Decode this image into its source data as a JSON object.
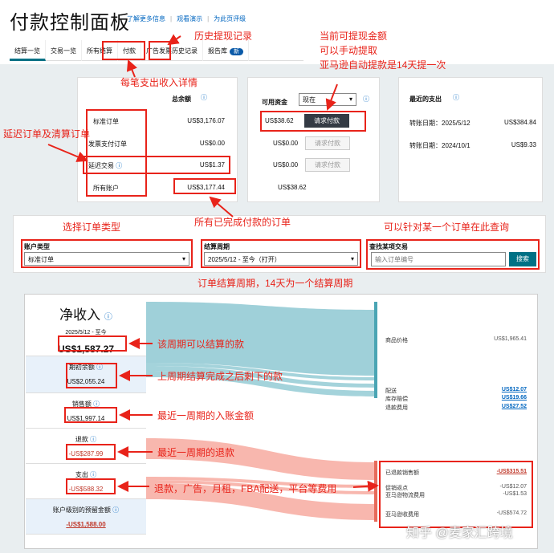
{
  "header": {
    "title": "付款控制面板",
    "links": [
      "了解更多信息",
      "观看演示",
      "为此页评级"
    ]
  },
  "tabs": [
    "结算一览",
    "交易一览",
    "所有结算",
    "付款",
    "广告发票历史记录",
    "报告库"
  ],
  "tab_badge": "新",
  "summary": {
    "col1_header": "总余额",
    "col2_header": "可用资金",
    "col2_select": "现在",
    "rows": [
      {
        "label": "标准订单",
        "total": "US$3,176.07",
        "avail": "US$38.62",
        "btn": "请求付款"
      },
      {
        "label": "发票支付订单",
        "total": "US$0.00",
        "avail": "US$0.00",
        "btn": "请求付款"
      },
      {
        "label": "延迟交易",
        "total": "US$1.37",
        "avail": "US$0.00",
        "btn": "请求付款"
      },
      {
        "label": "所有账户",
        "total": "US$3,177.44",
        "avail": "US$38.62",
        "btn": ""
      }
    ],
    "recent": {
      "title": "最近的支出",
      "rows": [
        {
          "label": "转账日期：2025/5/12",
          "value": "US$384.84"
        },
        {
          "label": "转账日期：2024/10/1",
          "value": "US$9.33"
        }
      ]
    }
  },
  "filters": {
    "account_type_label": "账户类型",
    "account_type_value": "标准订单",
    "period_label": "结算周期",
    "period_value": "2025/5/12 - 至今（打开）",
    "search_label": "查找某项交易",
    "search_placeholder": "输入订单编号",
    "search_btn": "搜索"
  },
  "net": {
    "title": "净收入",
    "date": "2025/5/12 - 至今",
    "value": "US$1,587.27",
    "items": [
      {
        "label": "期初余额",
        "value": "US$2,055.24"
      },
      {
        "label": "销售额",
        "value": "US$1,997.14"
      },
      {
        "label": "退款",
        "value": "-US$287.99"
      },
      {
        "label": "支出",
        "value": "-US$588.32"
      }
    ],
    "reserve_label": "账户级别的预留金额",
    "reserve_value": "-US$1,588.00"
  },
  "flows": [
    {
      "label": "商品价格",
      "value": "US$1,965.41",
      "u": false
    },
    {
      "label": "配送",
      "value": "US$12.07",
      "u": true
    },
    {
      "label": "库存赔偿",
      "value": "US$19.66",
      "u": true
    },
    {
      "label": "退款费用",
      "value": "US$27.52",
      "u": true
    },
    {
      "label": "已退款销售额",
      "value": "-US$315.51",
      "u": true
    },
    {
      "label": "促销返点",
      "value": "-US$12.07",
      "u": false
    },
    {
      "label": "亚马逊物流费用",
      "value": "-US$1.53",
      "u": false
    },
    {
      "label": "亚马逊收费用",
      "value": "-US$574.72",
      "u": false
    }
  ],
  "annotations": {
    "history": "历史提现记录",
    "withdraw1": "当前可提现金额",
    "withdraw2": "可以手动提取",
    "withdraw3": "亚马逊自动提款是14天提一次",
    "detail": "每笔支出收入详情",
    "delay": "延迟订单及清算订单",
    "done": "所有已完成付款的订单",
    "choose": "选择订单类型",
    "query": "可以针对某一个订单在此查询",
    "period": "订单结算周期，14天为一个结算周期",
    "a1": "该周期可以结算的款",
    "a2": "上周期结算完成之后剩下的款",
    "a3": "最近一周期的入账金额",
    "a4": "最近一周期的退款",
    "a5": "退款，广告，月租，FBA配送，平台等费用"
  },
  "watermark": "知乎 @麦家汇跨境"
}
